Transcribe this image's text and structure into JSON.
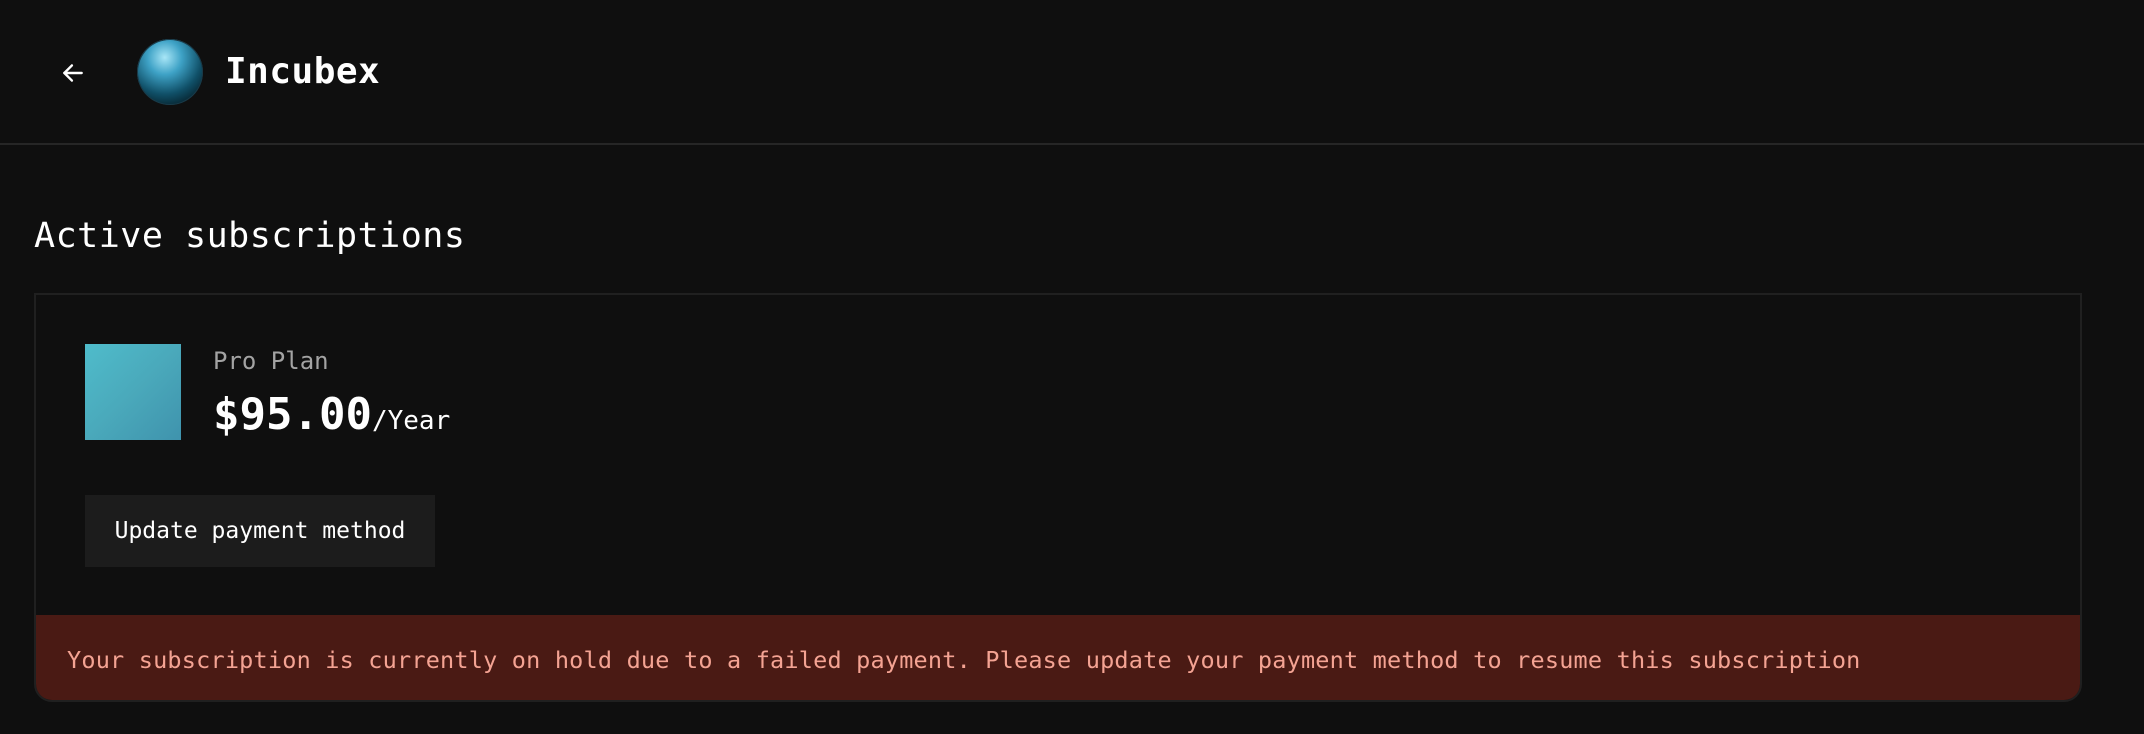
{
  "header": {
    "back_icon": "arrow-left-icon",
    "app_name": "Incubex"
  },
  "main": {
    "section_title": "Active subscriptions",
    "subscription": {
      "plan_name": "Pro Plan",
      "price": "$95.00",
      "period": "/Year",
      "update_button_label": "Update payment method",
      "alert_message": "Your subscription is currently on hold due to a failed payment. Please update your payment method to resume this subscription"
    }
  },
  "colors": {
    "background": "#0f0f0f",
    "alert_background": "#4a1a14",
    "alert_text": "#f4a393",
    "plan_thumbnail": "#4aa9bb"
  }
}
